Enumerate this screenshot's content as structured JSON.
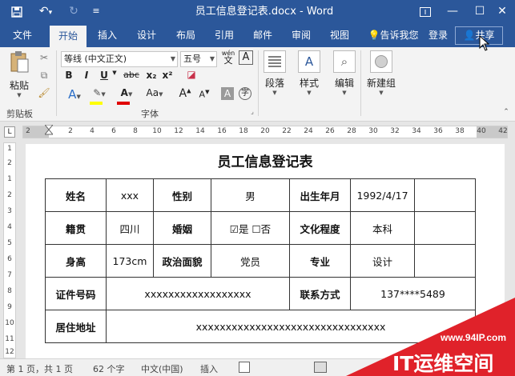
{
  "window": {
    "title": "员工信息登记表.docx - Word",
    "quick_access": {
      "save_icon": "save-icon",
      "undo_icon": "undo-icon",
      "redo_icon": "redo-icon",
      "customize_icon": "customize-icon"
    }
  },
  "tabs": [
    {
      "label": "文件"
    },
    {
      "label": "开始"
    },
    {
      "label": "插入"
    },
    {
      "label": "设计"
    },
    {
      "label": "布局"
    },
    {
      "label": "引用"
    },
    {
      "label": "邮件"
    },
    {
      "label": "审阅"
    },
    {
      "label": "视图"
    }
  ],
  "tellme": "告诉我您",
  "login": "登录",
  "share": "共享",
  "ribbon": {
    "paste": "粘贴",
    "clipboard_group": "剪贴板",
    "font_group": "字体",
    "font_name": "等线 (中文正文)",
    "font_size": "五号",
    "wen_label": "wén",
    "bold": "B",
    "italic": "I",
    "underline": "U",
    "strike": "abc",
    "subscript": "x₂",
    "superscript": "x²",
    "aa_label": "Aa",
    "paragraph": "段落",
    "styles": "样式",
    "editing": "编辑",
    "new_group": "新建组"
  },
  "ruler_ticks": [
    "2",
    "2",
    "4",
    "6",
    "8",
    "10",
    "12",
    "14",
    "16",
    "18",
    "20",
    "22",
    "24",
    "26",
    "28",
    "30",
    "32",
    "34",
    "36",
    "38",
    "40",
    "42"
  ],
  "vruler_ticks": [
    "1",
    "2",
    "1",
    "2",
    "3",
    "4",
    "5",
    "6",
    "7",
    "8",
    "9",
    "10",
    "11",
    "12"
  ],
  "document": {
    "title": "员工信息登记表",
    "rows": [
      [
        "姓名",
        "xxx",
        "性别",
        "男",
        "出生年月",
        "1992/4/17",
        ""
      ],
      [
        "籍贯",
        "四川",
        "婚姻",
        "☑是 ☐否",
        "文化程度",
        "本科",
        ""
      ],
      [
        "身高",
        "173cm",
        "政治面貌",
        "党员",
        "专业",
        "设计",
        ""
      ],
      [
        "证件号码",
        "xxxxxxxxxxxxxxxxxx",
        "联系方式",
        "137****5489"
      ],
      [
        "居住地址",
        "xxxxxxxxxxxxxxxxxxxxxxxxxxxxxxxx"
      ]
    ]
  },
  "status": {
    "page": "第 1 页，共 1 页",
    "words": "62 个字",
    "language": "中文(中国)",
    "mode": "插入"
  },
  "watermark": {
    "url": "www.94IP.com",
    "brand": "IT运维空间",
    "color": "#e0222a"
  },
  "colors": {
    "accent": "#2b579a",
    "ribbon_bg": "#f3f3f3"
  }
}
